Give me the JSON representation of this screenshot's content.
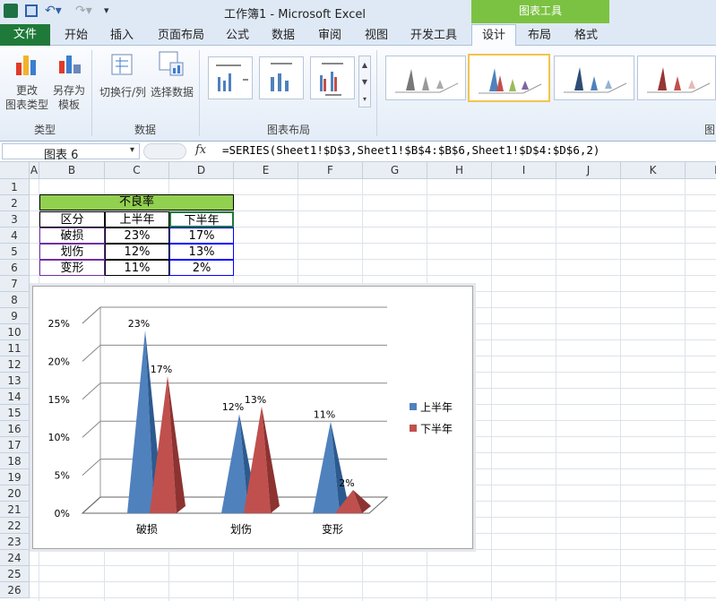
{
  "title_bar": {
    "title": "工作簿1 - Microsoft Excel",
    "chart_tools": "图表工具"
  },
  "tabs": [
    "文件",
    "开始",
    "插入",
    "页面布局",
    "公式",
    "数据",
    "审阅",
    "视图",
    "开发工具",
    "设计",
    "布局",
    "格式"
  ],
  "ribbon": {
    "change_type": "更改\n图表类型",
    "change_type_l1": "更改",
    "change_type_l2": "图表类型",
    "save_template_l1": "另存为",
    "save_template_l2": "模板",
    "switch_rowcol": "切换行/列",
    "select_data": "选择数据",
    "group_type": "类型",
    "group_data": "数据",
    "group_layout": "图表布局",
    "group_style_partial": "图"
  },
  "formula": {
    "name_box": "图表 6",
    "fx": "fx",
    "value": "=SERIES(Sheet1!$D$3,Sheet1!$B$4:$B$6,Sheet1!$D$4:$D$6,2)"
  },
  "columns": [
    "A",
    "B",
    "C",
    "D",
    "E",
    "F",
    "G",
    "H",
    "I",
    "J",
    "K",
    "L"
  ],
  "rows": [
    "1",
    "2",
    "3",
    "4",
    "5",
    "6",
    "7",
    "8",
    "9",
    "10",
    "11",
    "12",
    "13",
    "14",
    "15",
    "16",
    "17",
    "18",
    "19",
    "20",
    "21",
    "22",
    "23",
    "24",
    "25",
    "26"
  ],
  "table": {
    "title": "不良率",
    "headers": [
      "区分",
      "上半年",
      "下半年"
    ],
    "rows": [
      [
        "破损",
        "23%",
        "17%"
      ],
      [
        "划伤",
        "12%",
        "13%"
      ],
      [
        "变形",
        "11%",
        "2%"
      ]
    ]
  },
  "chart_data": {
    "type": "bar",
    "categories": [
      "破损",
      "划伤",
      "变形"
    ],
    "series": [
      {
        "name": "上半年",
        "values": [
          23,
          12,
          11
        ],
        "labels": [
          "23%",
          "12%",
          "11%"
        ],
        "color": "#4f81bd"
      },
      {
        "name": "下半年",
        "values": [
          17,
          13,
          2
        ],
        "labels": [
          "17%",
          "13%",
          "2%"
        ],
        "color": "#c0504d"
      }
    ],
    "yticks": [
      "0%",
      "5%",
      "10%",
      "15%",
      "20%",
      "25%"
    ],
    "ylim": [
      0,
      25
    ],
    "legend": "right",
    "grid": true
  },
  "colors": {
    "accent": "#2c72c7",
    "file_tab": "#1f7a3a",
    "chart_tools": "#7cc242",
    "table_header": "#92d050"
  }
}
